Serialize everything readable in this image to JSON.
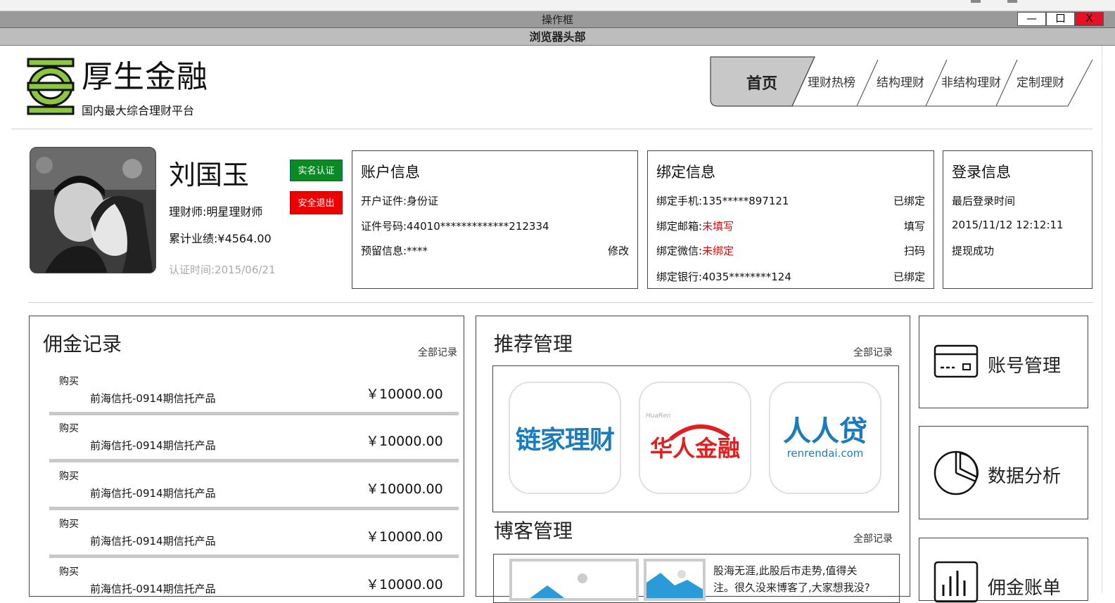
{
  "window": {
    "title": "操作框",
    "browser_header": "浏览器头部",
    "min_label": "—",
    "max_label": "口",
    "close_label": "X"
  },
  "brand": {
    "name": "厚生金融",
    "slogan": "国内最大综合理财平台",
    "logo_color": "#8dc63f"
  },
  "nav": {
    "tabs": [
      {
        "label": "首页",
        "active": true
      },
      {
        "label": "理财热榜"
      },
      {
        "label": "结构理财"
      },
      {
        "label": "非结构理财"
      },
      {
        "label": "定制理财"
      }
    ]
  },
  "user": {
    "name": "刘国玉",
    "title": "理财师:明星理财师",
    "performance": "累计业绩:¥4564.00",
    "cert_time": "认证时间:2015/06/21",
    "verify_button": "实名认证",
    "logout_button": "安全退出"
  },
  "account": {
    "heading": "账户信息",
    "id_type": "开户证件:身份证",
    "id_number": "证件号码:44010*************212334",
    "reserved": "预留信息:****",
    "edit_label": "修改"
  },
  "binding": {
    "heading": "绑定信息",
    "phone_label": "绑定手机:",
    "phone_value": "135*****897121",
    "phone_status": "已绑定",
    "email_label": "绑定邮箱:",
    "email_value": "未填写",
    "email_action": "填写",
    "wechat_label": "绑定微信:",
    "wechat_value": "未绑定",
    "wechat_action": "扫码",
    "bank_label": "绑定银行:",
    "bank_value": "4035********124",
    "bank_status": "已绑定"
  },
  "login": {
    "heading": "登录信息",
    "last_label": "最后登录时间",
    "last_time": "2015/11/12 12:12:11",
    "status": "提现成功"
  },
  "commission": {
    "title": "佣金记录",
    "more": "全部记录",
    "rows": [
      {
        "type": "购买",
        "product": "前海信托-0914期信托产品",
        "amount": "￥10000.00"
      },
      {
        "type": "购买",
        "product": "前海信托-0914期信托产品",
        "amount": "￥10000.00"
      },
      {
        "type": "购买",
        "product": "前海信托-0914期信托产品",
        "amount": "￥10000.00"
      },
      {
        "type": "购买",
        "product": "前海信托-0914期信托产品",
        "amount": "￥10000.00"
      },
      {
        "type": "购买",
        "product": "前海信托-0914期信托产品",
        "amount": "￥10000.00"
      }
    ]
  },
  "recommend": {
    "title": "推荐管理",
    "more": "全部记录",
    "partners": [
      {
        "name": "链家理财",
        "color": "#1a7bbd"
      },
      {
        "name": "华人金融",
        "small": "HuaRen",
        "color": "#e02020"
      },
      {
        "name": "人人贷",
        "sub": "renrendai.com",
        "color": "#1a7bbd"
      }
    ]
  },
  "blog": {
    "title": "博客管理",
    "more": "全部记录",
    "line1": "股海无涯,此股后市走势,值得关",
    "line2": "注。很久没来博客了,大家想我没?"
  },
  "side": {
    "account_mgmt": "账号管理",
    "data_analysis": "数据分析",
    "commission_bill": "佣金账单"
  }
}
